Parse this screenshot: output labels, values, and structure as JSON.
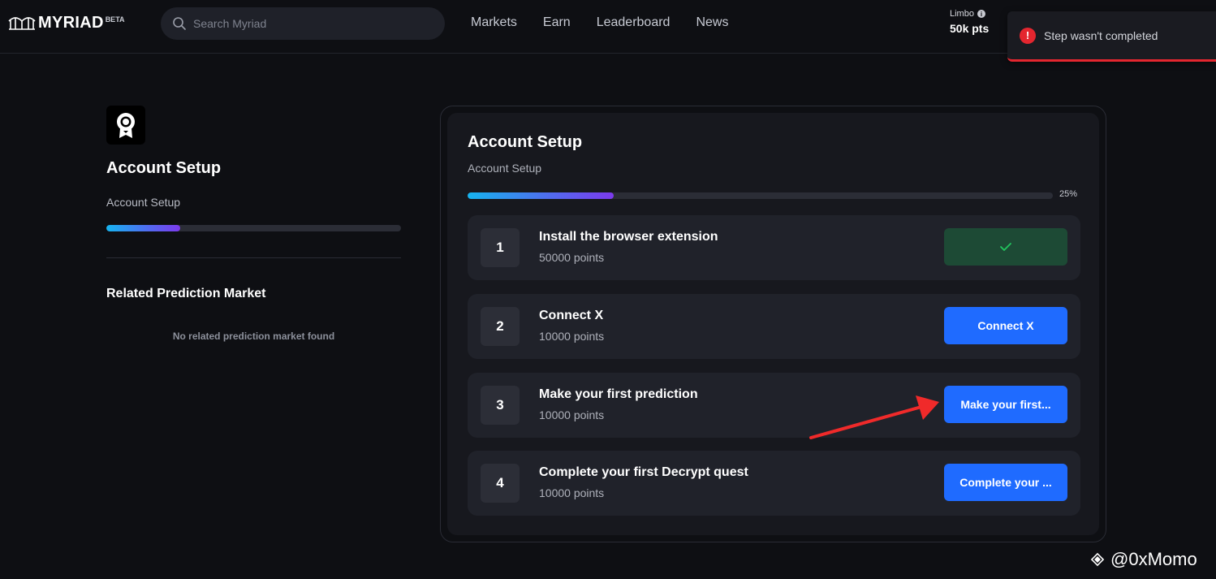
{
  "header": {
    "logo": "MYRIAD",
    "logo_badge": "BETA",
    "search_placeholder": "Search Myriad",
    "nav": [
      "Markets",
      "Earn",
      "Leaderboard",
      "News"
    ],
    "points_label": "Limbo",
    "points_value": "50k pts"
  },
  "toast": {
    "message": "Step wasn't completed",
    "color": "#e4262f"
  },
  "sidebar": {
    "title": "Account Setup",
    "subtitle": "Account Setup",
    "progress_fraction": 0.25,
    "related_title": "Related Prediction Market",
    "related_empty": "No related prediction market found"
  },
  "card": {
    "title": "Account Setup",
    "subtitle": "Account Setup",
    "progress_label": "25%",
    "progress_fraction": 0.25,
    "steps": [
      {
        "number": "1",
        "title": "Install the browser extension",
        "points": "50000 points",
        "button": "",
        "completed": true
      },
      {
        "number": "2",
        "title": "Connect X",
        "points": "10000 points",
        "button": "Connect X",
        "completed": false
      },
      {
        "number": "3",
        "title": "Make your first prediction",
        "points": "10000 points",
        "button": "Make your first...",
        "completed": false
      },
      {
        "number": "4",
        "title": "Complete your first Decrypt quest",
        "points": "10000 points",
        "button": "Complete your ...",
        "completed": false
      }
    ]
  },
  "watermark": "@0xMomo",
  "colors": {
    "accent": "#1f6bff",
    "success_bg": "#1d4a35",
    "success_check": "#22c55e",
    "annotation_arrow": "#f02a2a"
  }
}
